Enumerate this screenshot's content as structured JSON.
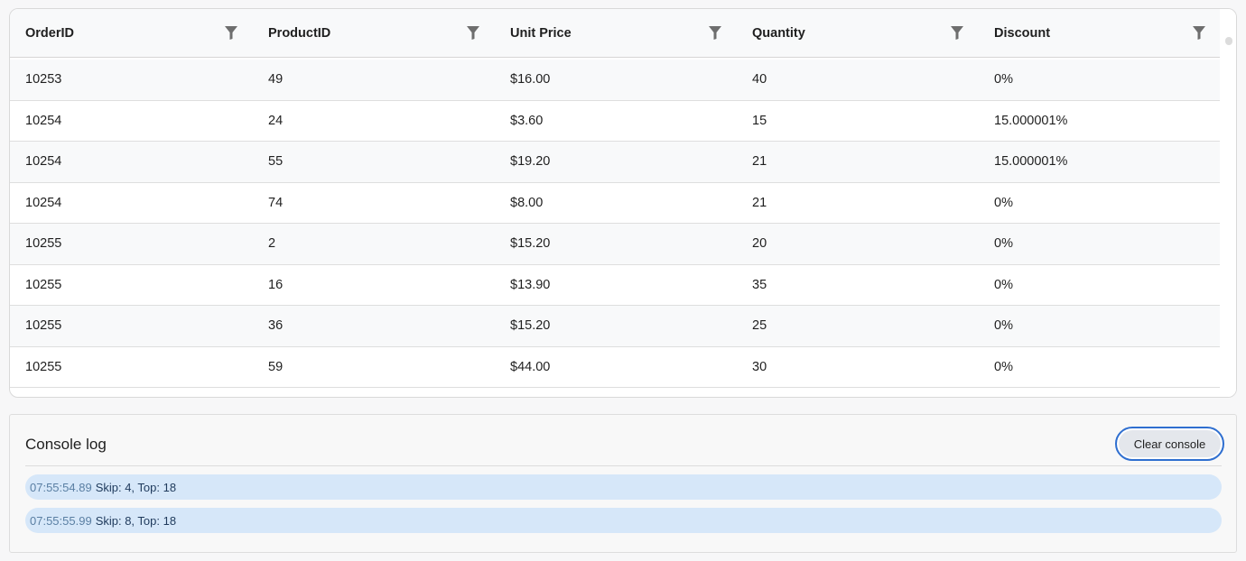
{
  "grid": {
    "columns": [
      {
        "label": "OrderID",
        "filter_icon": "filter-icon"
      },
      {
        "label": "ProductID",
        "filter_icon": "filter-icon"
      },
      {
        "label": "Unit Price",
        "filter_icon": "filter-icon"
      },
      {
        "label": "Quantity",
        "filter_icon": "filter-icon"
      },
      {
        "label": "Discount",
        "filter_icon": "filter-icon"
      }
    ],
    "rows": [
      [
        "10253",
        "49",
        "$16.00",
        "40",
        "0%"
      ],
      [
        "10254",
        "24",
        "$3.60",
        "15",
        "15.000001%"
      ],
      [
        "10254",
        "55",
        "$19.20",
        "21",
        "15.000001%"
      ],
      [
        "10254",
        "74",
        "$8.00",
        "21",
        "0%"
      ],
      [
        "10255",
        "2",
        "$15.20",
        "20",
        "0%"
      ],
      [
        "10255",
        "16",
        "$13.90",
        "35",
        "0%"
      ],
      [
        "10255",
        "36",
        "$15.20",
        "25",
        "0%"
      ],
      [
        "10255",
        "59",
        "$44.00",
        "30",
        "0%"
      ]
    ]
  },
  "console": {
    "title": "Console log",
    "clear_label": "Clear console",
    "entries": [
      {
        "time": "07:55:54.89",
        "message": "Skip: 4, Top: 18"
      },
      {
        "time": "07:55:55.99",
        "message": "Skip: 8, Top: 18"
      }
    ]
  },
  "colors": {
    "accent": "#2f6fd0",
    "log_background": "#d6e7f9",
    "header_background": "#f8f9fa"
  }
}
